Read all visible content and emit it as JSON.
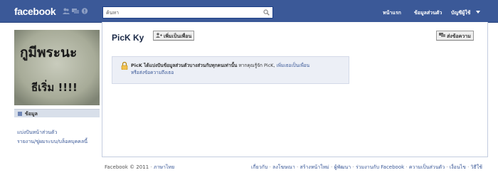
{
  "topbar": {
    "logo": "facebook",
    "search_placeholder": "ค้นหา",
    "nav": {
      "home": "หน้าแรก",
      "profile": "ข้อมูลส่วนตัว",
      "account": "บัญชีผู้ใช้"
    }
  },
  "colors": {
    "brand": "#3b5998",
    "link": "#3b5998",
    "notice_bg": "#eceff6"
  },
  "left": {
    "info_tab": "ข้อมูล",
    "links": [
      "แบ่งปันหน้าส่วนตัว",
      "รายงาน/ขู่ผมระบบ/บล็อคบุคคลนี้"
    ]
  },
  "profile": {
    "name": "PicK Ky",
    "add_friend": "เพิ่มเป็นเพื่อน",
    "send_message": "ส่งข้อความ",
    "picture_text": {
      "line1": "กูมีพระนะ",
      "line2": "ธีเริ่ม !!!!"
    }
  },
  "notice": {
    "bold": "PicK ได้แบ่งปันข้อมูลส่วนตัวบางส่วนกับทุกคนเท่านั้น",
    "mid": "หากคุณรู้จัก PicK,",
    "link1": "เพิ่มเธอเป็นเพื่อน",
    "link2": "หรือส่งข้อความถึงเธอ"
  },
  "footer": {
    "copyright": "Facebook © 2011",
    "language": "ภาษาไทย",
    "links": [
      "เกี่ยวกับ",
      "ลงโฆษณา",
      "สร้างหน้าใหม่",
      "ผู้พัฒนา",
      "ร่วมงานกับ Facebook",
      "ความเป็นส่วนตัว",
      "เงื่อนไข",
      "วิธีใช้"
    ]
  }
}
